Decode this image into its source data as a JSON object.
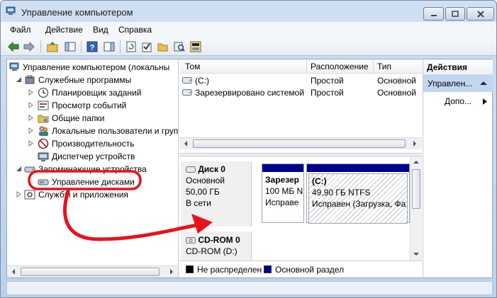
{
  "window": {
    "title": "Управление компьютером"
  },
  "menu": {
    "items": [
      "Файл",
      "Действие",
      "Вид",
      "Справка"
    ]
  },
  "toolbar": {
    "buttons": [
      "back-arrow-icon",
      "forward-arrow-icon",
      "up-folder-icon",
      "show-hide-tree-icon",
      "help-icon",
      "properties-icon",
      "refresh-icon",
      "check-icon",
      "open-folder-icon",
      "search-icon",
      "disk-wizard-icon"
    ]
  },
  "tree": {
    "items": [
      {
        "label": "Управление компьютером (локальны",
        "icon": "computer-icon"
      },
      {
        "label": "Служебные программы",
        "icon": "tools-icon"
      },
      {
        "label": "Планировщик заданий",
        "icon": "clock-icon"
      },
      {
        "label": "Просмотр событий",
        "icon": "event-viewer-icon"
      },
      {
        "label": "Общие папки",
        "icon": "shared-folder-icon"
      },
      {
        "label": "Локальные пользователи и груп",
        "icon": "users-icon"
      },
      {
        "label": "Производительность",
        "icon": "performance-icon"
      },
      {
        "label": "Диспетчер устройств",
        "icon": "device-manager-icon"
      },
      {
        "label": "Запоминающие устройства",
        "icon": "storage-icon"
      },
      {
        "label": "Управление дисками",
        "icon": "disk-management-icon",
        "selected": true
      },
      {
        "label": "Службы и приложения",
        "icon": "services-icon"
      }
    ]
  },
  "volumes": {
    "headers": [
      "Том",
      "Расположение",
      "Тип"
    ],
    "rows": [
      {
        "name": "(C:)",
        "location": "Простой",
        "type": "Основной"
      },
      {
        "name": "Зарезервировано системой",
        "location": "Простой",
        "type": "Основной"
      }
    ]
  },
  "disks": [
    {
      "title": "Диск 0",
      "kind": "Основной",
      "size": "50,00 ГБ",
      "state": "В сети",
      "partitions": [
        {
          "name": "Зарезер",
          "size": "100 МБ N",
          "status": "Исправе"
        },
        {
          "name": "(C:)",
          "size": "49,90 ГБ NTFS",
          "status": "Исправен (Загрузка, Фа"
        }
      ]
    },
    {
      "title": "CD-ROM 0",
      "kind": "CD-ROM (D:)"
    }
  ],
  "legend": {
    "items": [
      {
        "label": "Не распределен",
        "color": "#000000"
      },
      {
        "label": "Основной раздел",
        "color": "#00008b"
      }
    ]
  },
  "actions": {
    "header": "Действия",
    "section": "Управлен...",
    "item": "Допо..."
  },
  "colors": {
    "annotation": "#e8121b",
    "selection": "#c2d6ef",
    "primary_partition": "#00008b"
  }
}
